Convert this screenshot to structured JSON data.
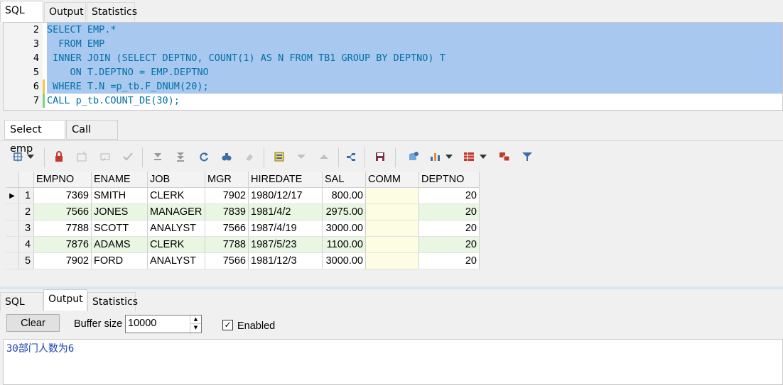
{
  "top_tabs": [
    "SQL",
    "Output",
    "Statistics"
  ],
  "editor": {
    "lines": [
      {
        "num": "2",
        "text": "SELECT EMP.*"
      },
      {
        "num": "3",
        "text": "  FROM EMP"
      },
      {
        "num": "4",
        "text": " INNER JOIN (SELECT DEPTNO, COUNT(1) AS N FROM TB1 GROUP BY DEPTNO) T"
      },
      {
        "num": "5",
        "text": "    ON T.DEPTNO = EMP.DEPTNO"
      },
      {
        "num": "6",
        "text": " WHERE T.N =p_tb.F_DNUM(20);"
      },
      {
        "num": "7",
        "text": "CALL p_tb.COUNT_DE(30);"
      }
    ]
  },
  "result_tabs": [
    "Select emp",
    "Call"
  ],
  "toolbar_icons": [
    "grid-options-icon",
    "dropdown-arrow-icon",
    "lock-icon",
    "new-record-icon",
    "delete-record-icon",
    "post-check-icon",
    "fetch-next-icon",
    "fetch-all-icon",
    "refresh-icon",
    "find-icon",
    "clear-icon",
    "query-by-example-icon",
    "previous-icon",
    "next-icon",
    "single-record-icon",
    "save-icon",
    "export-icon",
    "chart-icon",
    "chart-dropdown-icon",
    "table-icon",
    "table-dropdown-icon",
    "compare-icon",
    "filter-icon"
  ],
  "grid": {
    "columns": [
      "EMPNO",
      "ENAME",
      "JOB",
      "MGR",
      "HIREDATE",
      "SAL",
      "COMM",
      "DEPTNO"
    ],
    "rows": [
      {
        "n": "1",
        "empno": "7369",
        "ename": "SMITH",
        "job": "CLERK",
        "mgr": "7902",
        "hiredate": "1980/12/17",
        "sal": "800.00",
        "comm": "",
        "deptno": "20"
      },
      {
        "n": "2",
        "empno": "7566",
        "ename": "JONES",
        "job": "MANAGER",
        "mgr": "7839",
        "hiredate": "1981/4/2",
        "sal": "2975.00",
        "comm": "",
        "deptno": "20"
      },
      {
        "n": "3",
        "empno": "7788",
        "ename": "SCOTT",
        "job": "ANALYST",
        "mgr": "7566",
        "hiredate": "1987/4/19",
        "sal": "3000.00",
        "comm": "",
        "deptno": "20"
      },
      {
        "n": "4",
        "empno": "7876",
        "ename": "ADAMS",
        "job": "CLERK",
        "mgr": "7788",
        "hiredate": "1987/5/23",
        "sal": "1100.00",
        "comm": "",
        "deptno": "20"
      },
      {
        "n": "5",
        "empno": "7902",
        "ename": "FORD",
        "job": "ANALYST",
        "mgr": "7566",
        "hiredate": "1981/12/3",
        "sal": "3000.00",
        "comm": "",
        "deptno": "20"
      }
    ]
  },
  "lower_tabs": [
    "SQL",
    "Output",
    "Statistics"
  ],
  "output_panel": {
    "clear_label": "Clear",
    "buffer_label": "Buffer size",
    "buffer_value": "10000",
    "enabled_label": "Enabled",
    "enabled_checked": true,
    "output_text": "30部门人数为6"
  },
  "colors": {
    "selection": "#a8c8ef",
    "keyword": "#0070a8",
    "row_alt": "#e8f6e2",
    "comm_bg": "#fdfde3",
    "output_text": "#1a3fb8"
  }
}
